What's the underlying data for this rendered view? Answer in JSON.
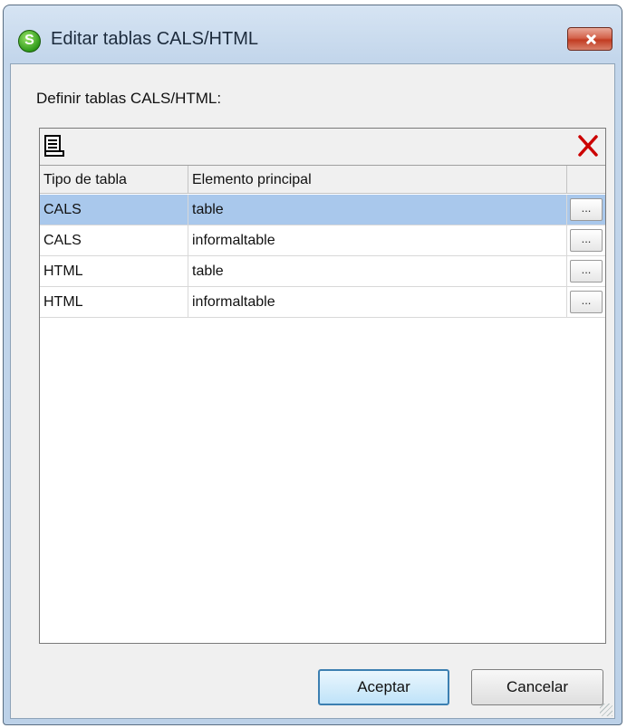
{
  "window": {
    "title": "Editar tablas CALS/HTML",
    "app_icon": "altova-s-icon"
  },
  "dialog": {
    "label": "Definir tablas CALS/HTML:"
  },
  "toolbar": {
    "append_icon": "append-row-icon",
    "delete_icon": "delete-x-icon"
  },
  "table": {
    "columns": [
      "Tipo de tabla",
      "Elemento principal"
    ],
    "rows": [
      {
        "type": "CALS",
        "element": "table",
        "selected": true
      },
      {
        "type": "CALS",
        "element": "informaltable",
        "selected": false
      },
      {
        "type": "HTML",
        "element": "table",
        "selected": false
      },
      {
        "type": "HTML",
        "element": "informaltable",
        "selected": false
      }
    ],
    "row_button_label": "..."
  },
  "buttons": {
    "ok": "Aceptar",
    "cancel": "Cancelar"
  },
  "colors": {
    "selection": "#a9c8ec",
    "delete": "#cc0000",
    "close": "#c23c22"
  }
}
